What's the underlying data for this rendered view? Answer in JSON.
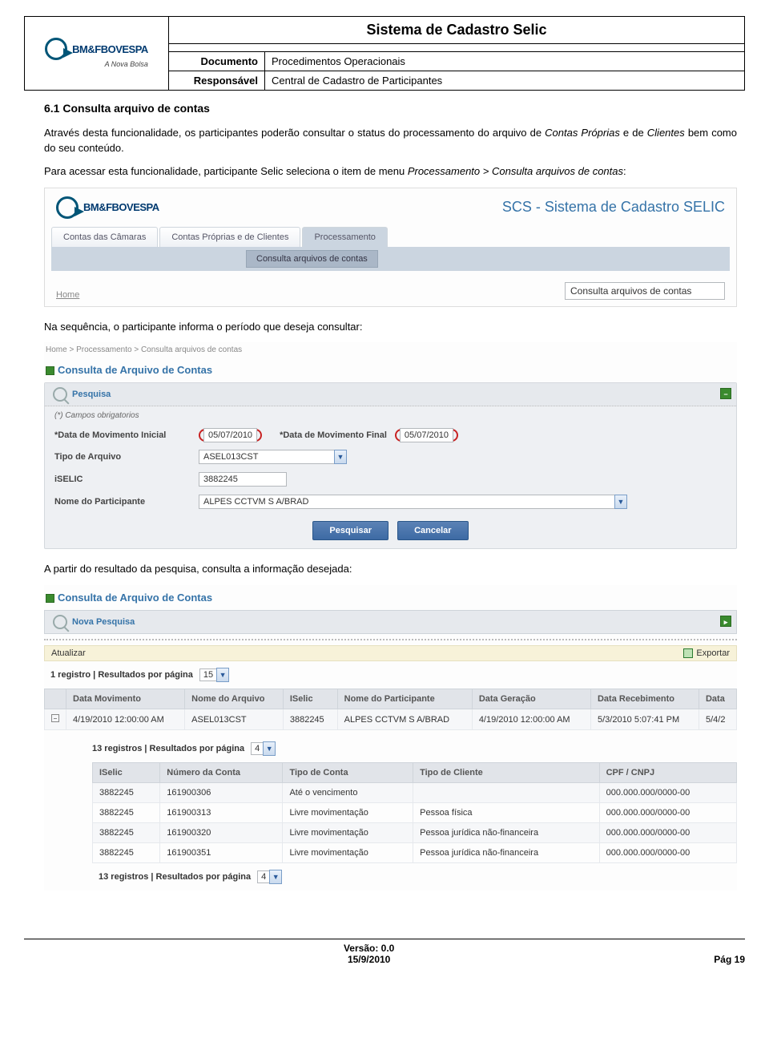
{
  "header": {
    "system_title": "Sistema de Cadastro Selic",
    "logo_name": "BM&FBOVESPA",
    "logo_tagline": "A Nova Bolsa",
    "doc_label": "Documento",
    "doc_value": "Procedimentos Operacionais",
    "resp_label": "Responsável",
    "resp_value": "Central de Cadastro de Participantes"
  },
  "section": {
    "number_title": "6.1   Consulta arquivo de contas",
    "para1_a": "Através desta funcionalidade, os participantes poderão consultar o status do processamento do arquivo de ",
    "para1_i1": "Contas Próprias",
    "para1_b": " e de ",
    "para1_i2": "Clientes",
    "para1_c": " bem como do seu conteúdo.",
    "para2_a": "Para acessar esta funcionalidade, participante Selic seleciona o item de menu ",
    "para2_i": "Processamento > Consulta arquivos de contas",
    "para2_b": ":",
    "para3": "Na sequência, o participante informa o período que deseja consultar:",
    "para4": "A partir do resultado da pesquisa, consulta a informação desejada:"
  },
  "shot1": {
    "scs_title": "SCS - Sistema de Cadastro SELIC",
    "tabs": [
      "Contas das Câmaras",
      "Contas Próprias e de Clientes",
      "Processamento"
    ],
    "submenu": "Consulta arquivos de contas",
    "home": "Home",
    "crumb_input": "Consulta arquivos de contas"
  },
  "shot2": {
    "breadcrumb": "Home > Processamento > Consulta arquivos de contas",
    "panel_title": "Consulta de Arquivo de Contas",
    "search_label": "Pesquisa",
    "required_note": "(*) Campos obrigatorios",
    "f_date_ini_label": "*Data de Movimento Inicial",
    "f_date_ini": "05/07/2010",
    "f_date_fim_label": "*Data de Movimento Final",
    "f_date_fim": "05/07/2010",
    "f_tipo_label": "Tipo de Arquivo",
    "f_tipo": "ASEL013CST",
    "f_iselic_label": "iSELIC",
    "f_iselic": "3882245",
    "f_nome_label": "Nome do Participante",
    "f_nome": "ALPES CCTVM S A/BRAD",
    "btn_search": "Pesquisar",
    "btn_cancel": "Cancelar"
  },
  "shot3": {
    "panel_title": "Consulta de Arquivo de Contas",
    "new_search": "Nova Pesquisa",
    "toolbar_update": "Atualizar",
    "toolbar_export": "Exportar",
    "pager1_a": "1 registro | Resultados por página",
    "pager1_sel": "15",
    "cols1": [
      "",
      "Data Movimento",
      "Nome do Arquivo",
      "ISelic",
      "Nome do Participante",
      "Data Geração",
      "Data Recebimento",
      "Data"
    ],
    "row1": [
      "",
      "4/19/2010 12:00:00 AM",
      "ASEL013CST",
      "3882245",
      "ALPES CCTVM S A/BRAD",
      "4/19/2010 12:00:00 AM",
      "5/3/2010 5:07:41 PM",
      "5/4/2"
    ],
    "pager2_a": "13 registros | Resultados por página",
    "pager2_sel": "4",
    "cols2": [
      "ISelic",
      "Número da Conta",
      "Tipo de Conta",
      "Tipo de Cliente",
      "CPF / CNPJ"
    ],
    "rows2": [
      [
        "3882245",
        "161900306",
        "Até o vencimento",
        "",
        "000.000.000/0000-00"
      ],
      [
        "3882245",
        "161900313",
        "Livre movimentação",
        "Pessoa física",
        "000.000.000/0000-00"
      ],
      [
        "3882245",
        "161900320",
        "Livre movimentação",
        "Pessoa jurídica não-financeira",
        "000.000.000/0000-00"
      ],
      [
        "3882245",
        "161900351",
        "Livre movimentação",
        "Pessoa jurídica não-financeira",
        "000.000.000/0000-00"
      ]
    ]
  },
  "footer": {
    "version_label": "Versão: 0.0",
    "date": "15/9/2010",
    "page": "Pág 19"
  }
}
